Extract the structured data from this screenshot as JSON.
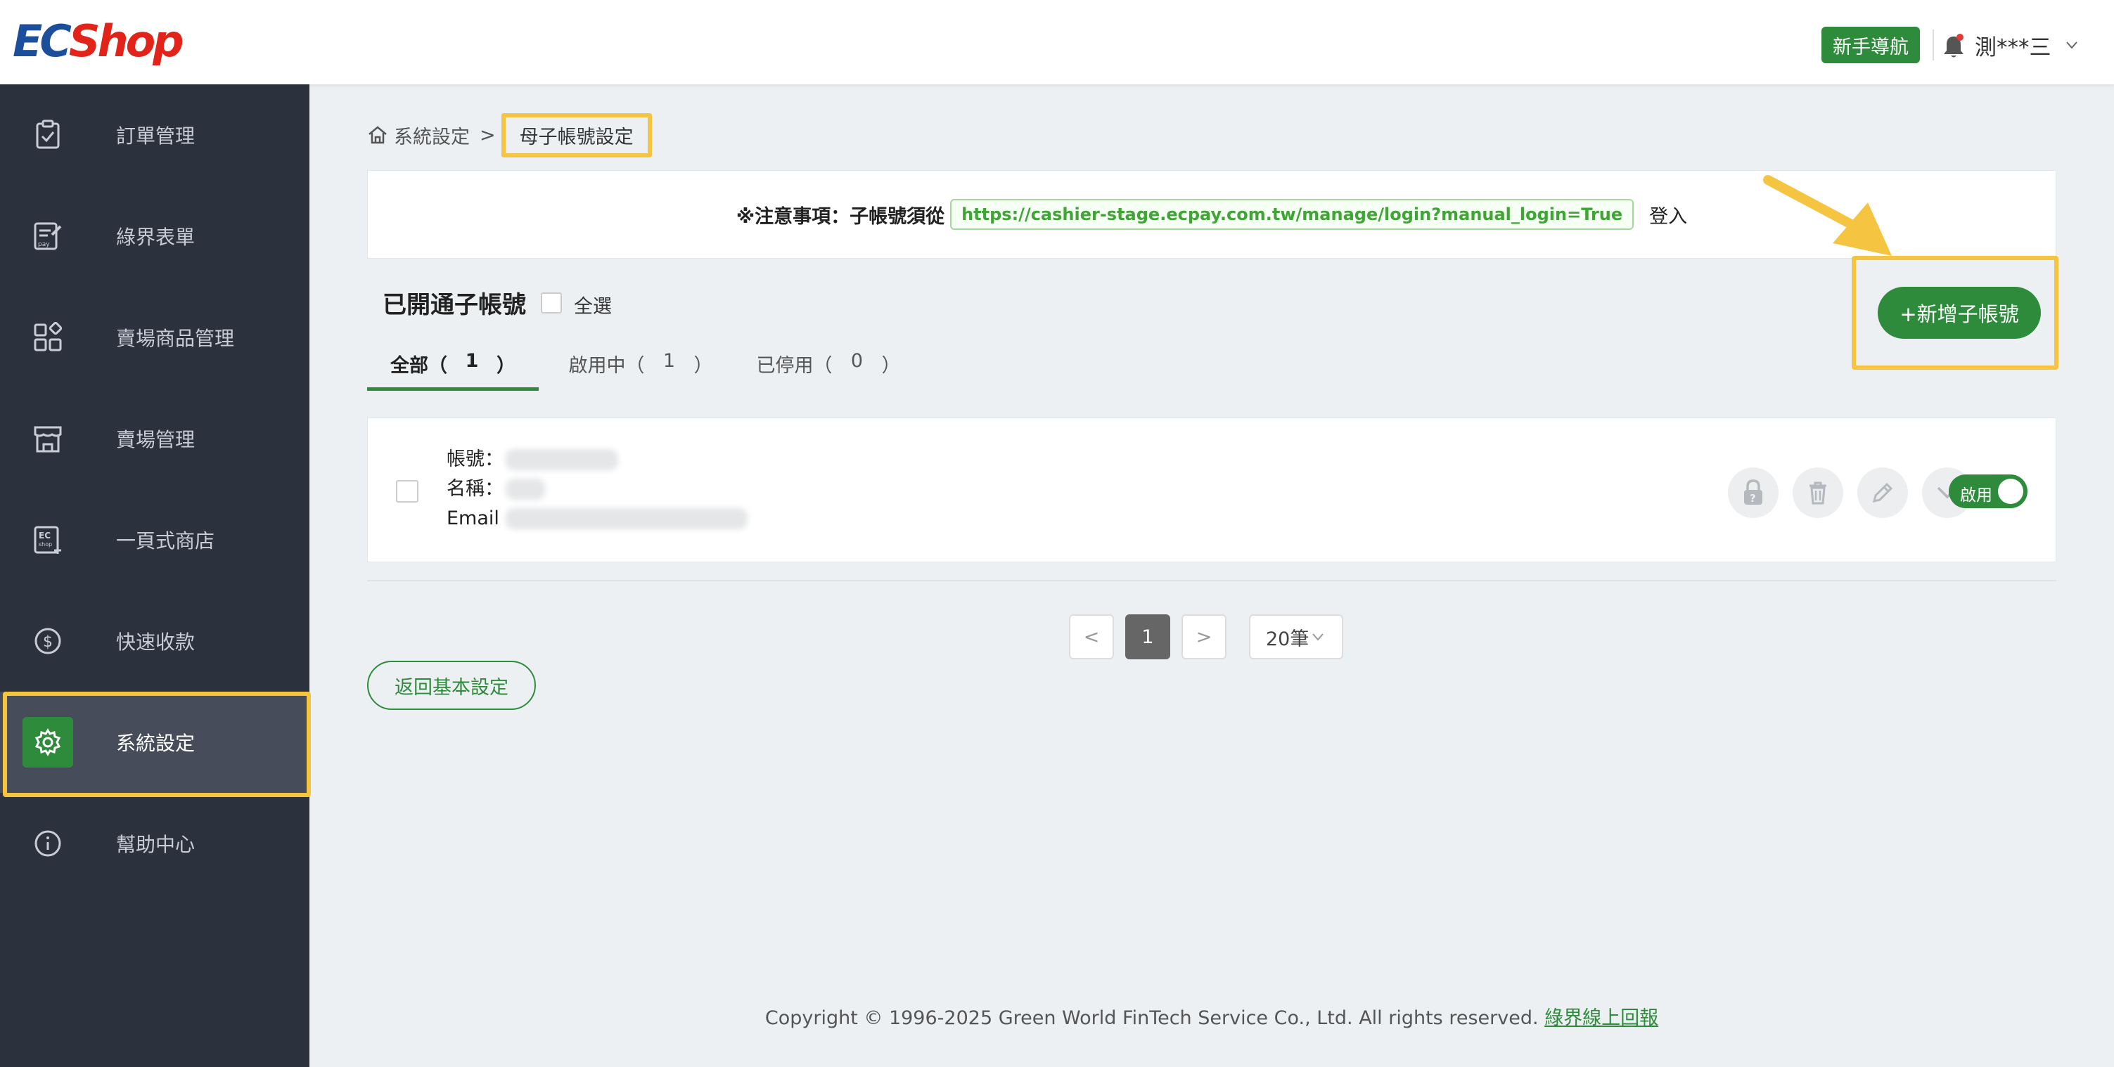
{
  "header": {
    "logo_ec": "EC",
    "logo_shop": "Shop",
    "guide_button": "新手導航",
    "user_name": "測***三"
  },
  "sidebar": {
    "items": [
      {
        "label": "訂單管理",
        "icon": "clipboard-check-icon"
      },
      {
        "label": "綠界表單",
        "icon": "pay-form-icon"
      },
      {
        "label": "賣場商品管理",
        "icon": "product-grid-icon"
      },
      {
        "label": "賣場管理",
        "icon": "storefront-icon"
      },
      {
        "label": "一頁式商店",
        "icon": "ec-shop-page-icon"
      },
      {
        "label": "快速收款",
        "icon": "dollar-circle-icon"
      },
      {
        "label": "系統設定",
        "icon": "gear-icon",
        "active": true
      },
      {
        "label": "幫助中心",
        "icon": "info-circle-icon"
      }
    ]
  },
  "breadcrumb": {
    "parent": "系統設定",
    "separator": ">",
    "current": "母子帳號設定"
  },
  "notice": {
    "prefix": "※注意事項：子帳號須從",
    "url": "https://cashier-stage.ecpay.com.tw/manage/login?manual_login=True",
    "suffix": "登入"
  },
  "section": {
    "title": "已開通子帳號",
    "select_all": "全選",
    "add_button": "+新增子帳號"
  },
  "tabs": [
    {
      "label": "全部（",
      "count": "1",
      "close": "）",
      "active": true
    },
    {
      "label": "啟用中（",
      "count": "1",
      "close": "）"
    },
    {
      "label": "已停用（",
      "count": "0",
      "close": "）"
    }
  ],
  "account": {
    "account_label": "帳號：",
    "name_label": "名稱：",
    "email_label": "Email",
    "status_toggle": "啟用"
  },
  "pagination": {
    "prev": "<",
    "current_page": "1",
    "next": ">",
    "page_size": "20筆"
  },
  "back_button": "返回基本設定",
  "footer": {
    "copyright": "Copyright © 1996-2025 Green World FinTech Service Co., Ltd. All rights reserved.",
    "link": "綠界線上回報"
  },
  "colors": {
    "brand_green": "#2e8b3c",
    "sidebar_bg": "#2c323d",
    "highlight": "#f5c542",
    "url_green": "#3fa535"
  }
}
